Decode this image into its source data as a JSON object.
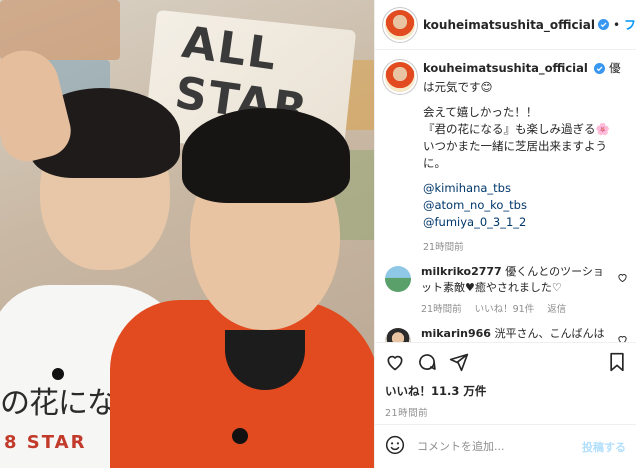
{
  "header": {
    "username": "kouheimatsushita_official",
    "separator": "•",
    "follow_label": "フ"
  },
  "photo": {
    "bg_sign_text": "ALL STAR",
    "shirt_text": "の花にな",
    "shirt_sub": "8 STAR"
  },
  "caption": {
    "username": "kouheimatsushita_official",
    "first_line": "優は元気です😊",
    "lines": [
      "会えて嬉しかった！！",
      "『君の花になる』も楽しみ過ぎる🌸",
      "いつかまた一緒に芝居出来ますように。"
    ],
    "mentions": [
      "@kimihana_tbs",
      "@atom_no_ko_tbs",
      "@fumiya_0_3_1_2"
    ],
    "time": "21時間前"
  },
  "comments": [
    {
      "username": "milkriko2777",
      "text": "優くんとのツーショット素敵♥癒やされました♡",
      "time": "21時間前",
      "likes": "いいね！91件",
      "reply": "返信"
    },
    {
      "username": "mikarin966",
      "text": "洸平さん、こんばんは"
    }
  ],
  "actions": {
    "likes_text": "いいね！11.3 万件",
    "time": "21時間前"
  },
  "comment_bar": {
    "placeholder": "コメントを追加...",
    "post_label": "投稿する"
  },
  "colors": {
    "accent": "#0095f6",
    "verified": "#3897f0",
    "mention": "#00376b",
    "muted": "#8e8e8e"
  }
}
